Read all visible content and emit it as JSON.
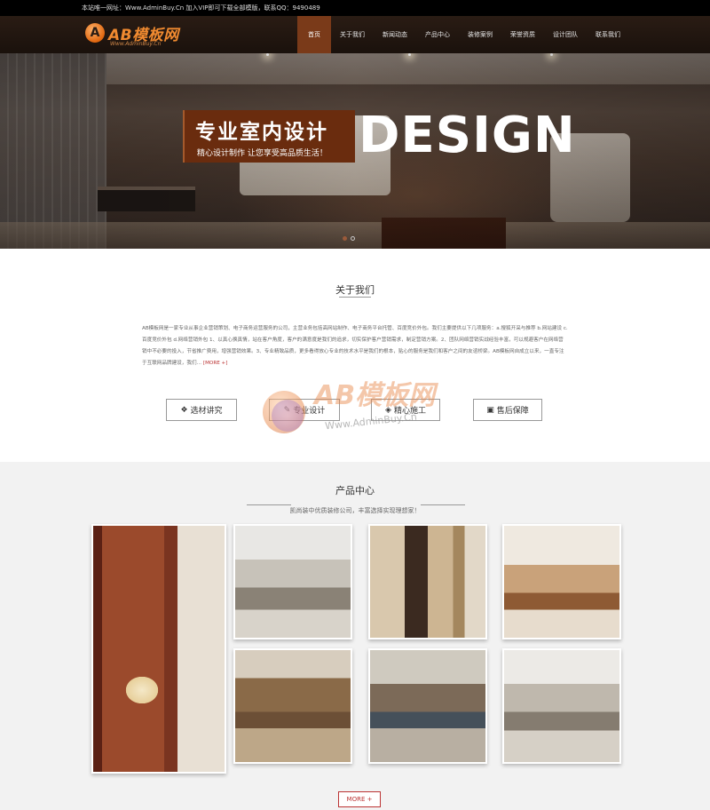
{
  "topbar": {
    "text": "本站唯一网址：Www.AdminBuy.Cn 加入VIP即可下载全部模版，联系QQ：9490489"
  },
  "logo": {
    "mark": "A",
    "name": "AB模板网",
    "url": "Www.AdminBuy.Cn"
  },
  "nav": {
    "items": [
      {
        "label": "首页"
      },
      {
        "label": "关于我们"
      },
      {
        "label": "新闻动态"
      },
      {
        "label": "产品中心"
      },
      {
        "label": "装修案例"
      },
      {
        "label": "荣誉资质"
      },
      {
        "label": "设计团队"
      },
      {
        "label": "联系我们"
      }
    ],
    "active_index": 0
  },
  "banner": {
    "title": "专业室内设计",
    "subtitle": "精心设计制作  让您享受高品质生活！",
    "design_text": "DESIGN",
    "slides": 2,
    "active_slide": 0
  },
  "about": {
    "title": "关于我们",
    "text": "AB模板网是一家专业从事企业营销策划、电子商务运营服务的公司，主营业务包括高网站制作、电子商务平台托管、百度竞价外包。我们主要提供以下几项服务：a.搜狐开采与推荐 b.网站建设 c.百度竞价外包 d.网络营销外包 1、以真心换真情，站在客户角度，客户的满意度是我们的追求，切实保护客户营销需求，制定营销方案。2、团队网络营销实战经验丰富，可以规避客户在网络营销中不必要的投入，节省推广费用，增强营销效果。3、专业精致品质，更多看得放心专业的技术水平是我们的根本，贴心的服务是我们和客户之间的友谊桥梁。AB模板网自成立以来，一直专注于互联网品牌建设，我们…",
    "more": "[MORE +]",
    "features": [
      {
        "label": "选材讲究",
        "icon": "cubes-icon"
      },
      {
        "label": "专业设计",
        "icon": "design-icon"
      },
      {
        "label": "精心施工",
        "icon": "shield-icon"
      },
      {
        "label": "售后保障",
        "icon": "monitor-icon"
      }
    ]
  },
  "watermark": {
    "name": "AB模板网",
    "url": "Www.AdminBuy.Cn"
  },
  "products": {
    "title": "产品中心",
    "subtitle": "凯尚装中优质装修公司，丰富选择实现理想家！",
    "more": "MORE +"
  },
  "colors": {
    "accent": "#7a3a19",
    "banner_box": "#6a2c0e",
    "more_red": "#bb3333"
  }
}
